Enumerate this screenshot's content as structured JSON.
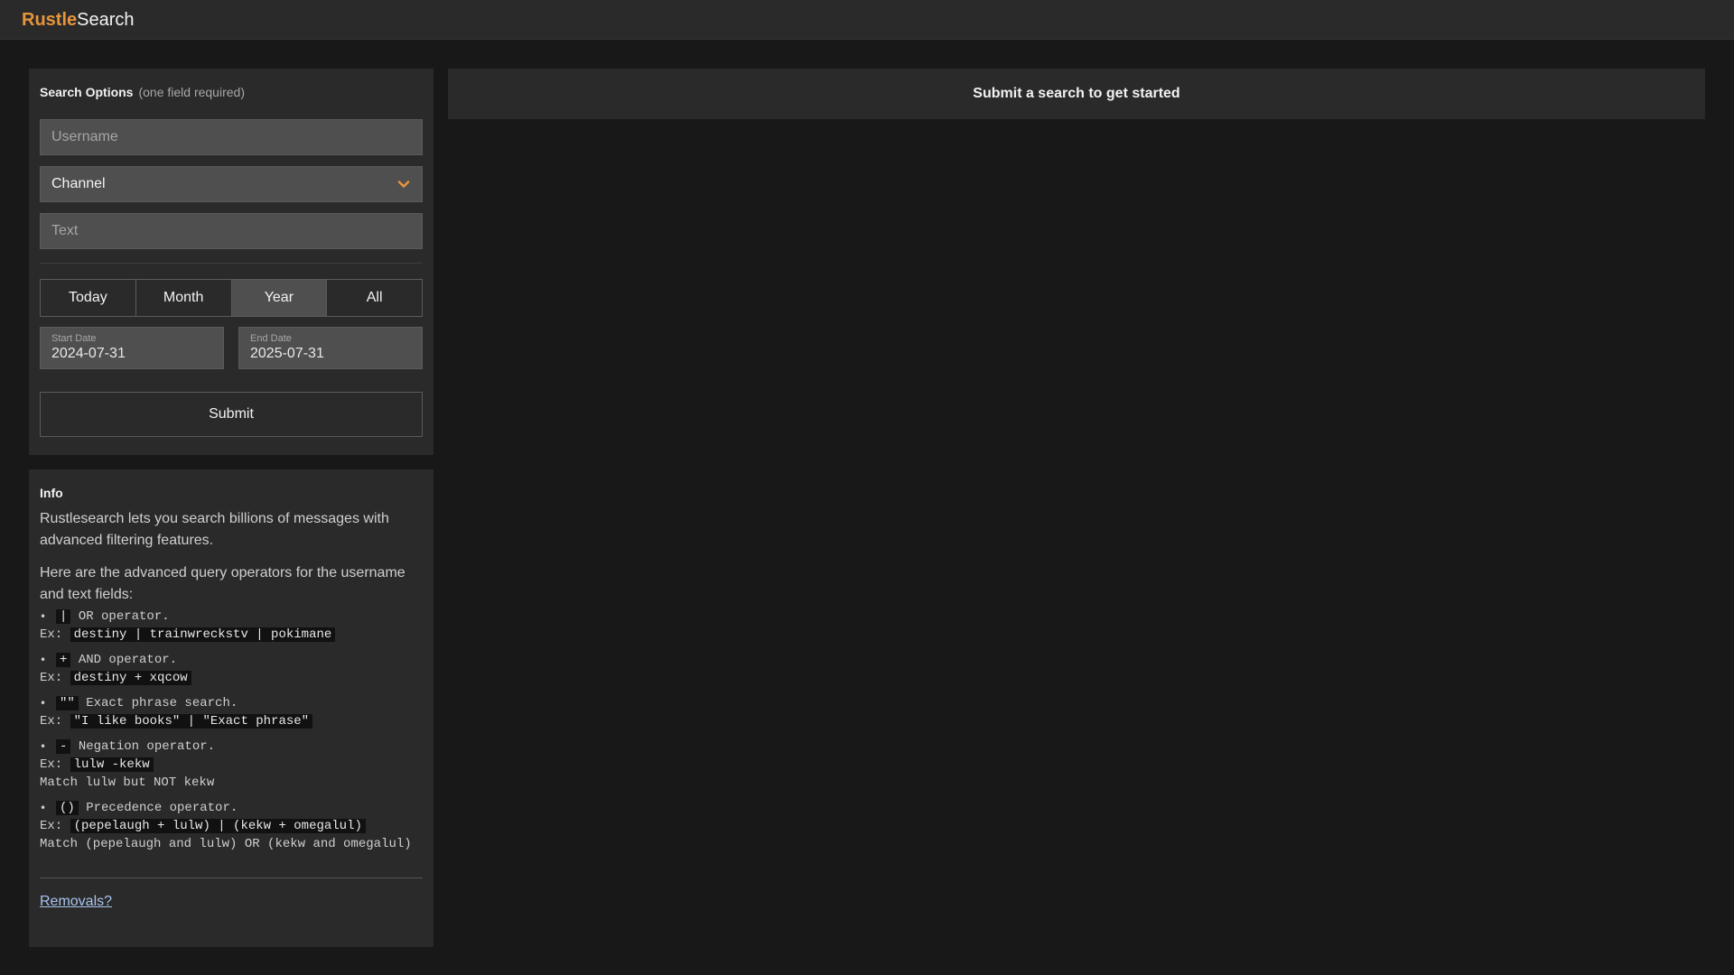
{
  "header": {
    "brand_accent": "Rustle",
    "brand_rest": "Search",
    "accent_color": "#e6953a"
  },
  "search": {
    "title": "Search Options",
    "subtitle": "(one field required)",
    "username_placeholder": "Username",
    "username_value": "",
    "channel_value": "Channel",
    "channel_icon": "chevron-down-icon",
    "text_placeholder": "Text",
    "text_value": "",
    "ranges": [
      "Today",
      "Month",
      "Year",
      "All"
    ],
    "active_range": "Year",
    "start_date_label": "Start Date",
    "start_date_value": "2024-07-31",
    "end_date_label": "End Date",
    "end_date_value": "2025-07-31",
    "submit_label": "Submit"
  },
  "info": {
    "title": "Info",
    "intro": "Rustlesearch lets you search billions of messages with advanced filtering features.",
    "operators_intro": "Here are the advanced query operators for the username and text fields:",
    "operators": [
      {
        "token": "|",
        "desc": "OR operator.",
        "example": "destiny | trainwreckstv | pokimane",
        "note": ""
      },
      {
        "token": "+",
        "desc": "AND operator.",
        "example": "destiny + xqcow",
        "note": ""
      },
      {
        "token": "\"\"",
        "desc": "Exact phrase search.",
        "example": "\"I like books\" | \"Exact phrase\"",
        "note": ""
      },
      {
        "token": "-",
        "desc": "Negation operator.",
        "example": "lulw -kekw",
        "note": "Match lulw but NOT kekw"
      },
      {
        "token": "()",
        "desc": "Precedence operator.",
        "example": "(pepelaugh + lulw) | (kekw + omegalul)",
        "note": "Match (pepelaugh and lulw) OR (kekw and omegalul)"
      }
    ],
    "example_prefix": "Ex:",
    "removals_label": "Removals?"
  },
  "results": {
    "message": "Submit a search to get started"
  }
}
